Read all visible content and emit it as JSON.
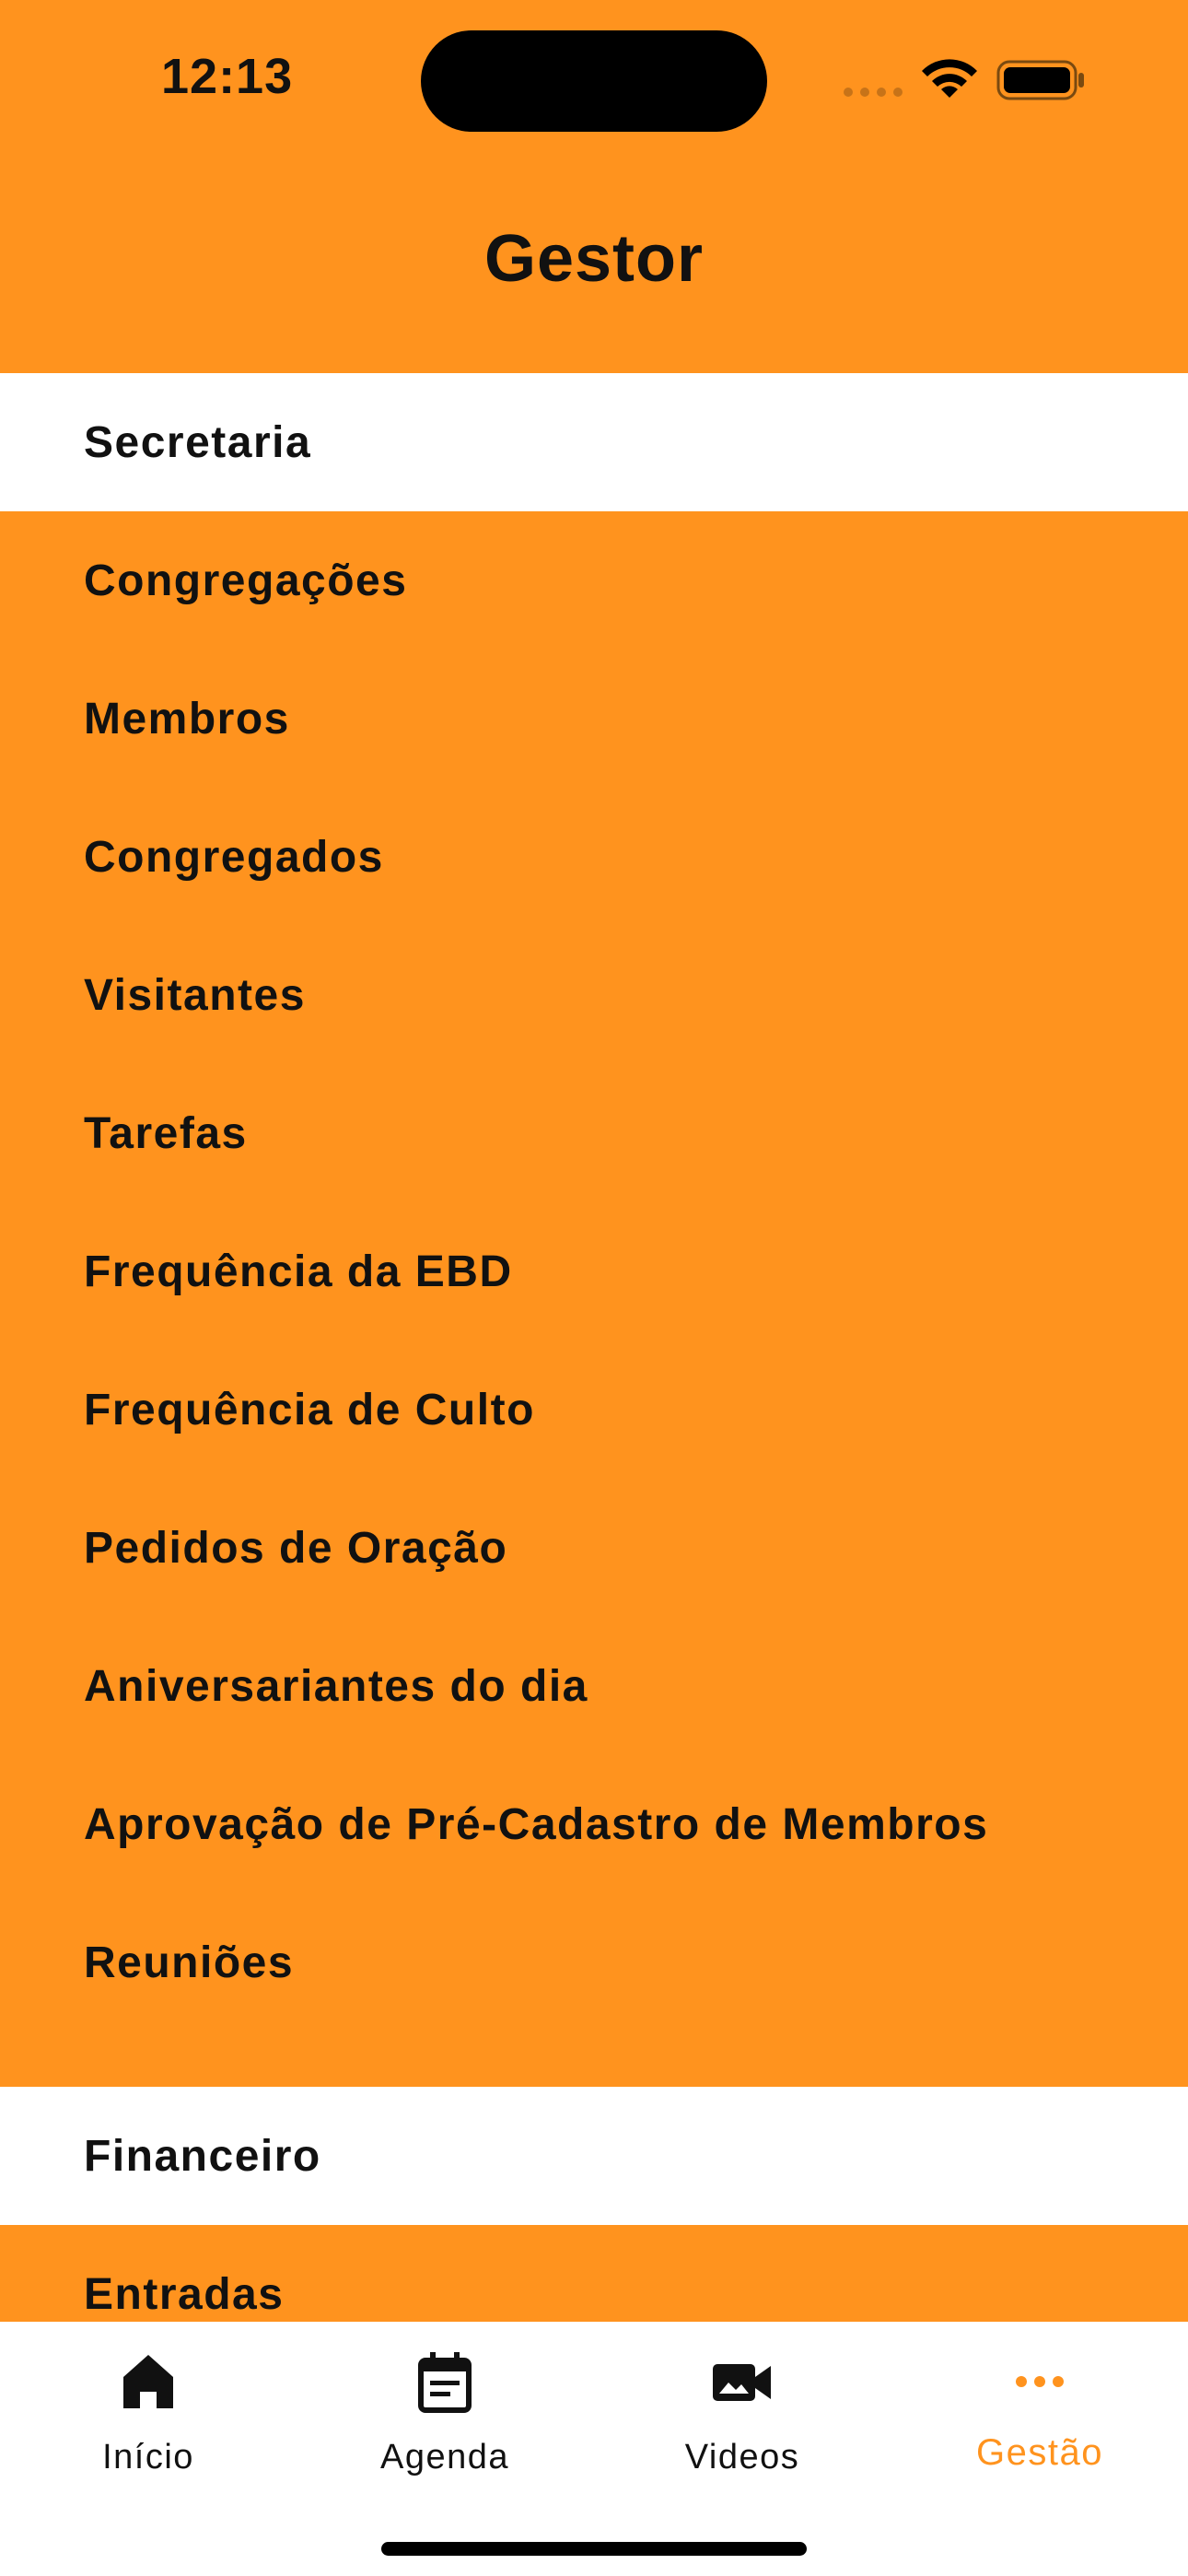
{
  "status_bar": {
    "time": "12:13"
  },
  "nav": {
    "title": "Gestor"
  },
  "sections": [
    {
      "header": "Secretaria",
      "items": [
        "Congregações",
        "Membros",
        "Congregados",
        "Visitantes",
        "Tarefas",
        "Frequência da EBD",
        "Frequência de Culto",
        "Pedidos de Oração",
        "Aniversariantes do dia",
        "Aprovação de Pré-Cadastro de Membros",
        "Reuniões"
      ]
    },
    {
      "header": "Financeiro",
      "items": [
        "Entradas"
      ]
    }
  ],
  "tab_bar": {
    "tabs": [
      {
        "label": "Início",
        "icon": "home-icon"
      },
      {
        "label": "Agenda",
        "icon": "calendar-icon"
      },
      {
        "label": "Videos",
        "icon": "video-camera-icon"
      },
      {
        "label": "Gestão",
        "icon": "more-dots-icon",
        "active": true
      }
    ]
  },
  "colors": {
    "accent": "#FF931E",
    "background": "#FF931E",
    "header_bg": "#FFFFFF",
    "text": "#111111"
  }
}
